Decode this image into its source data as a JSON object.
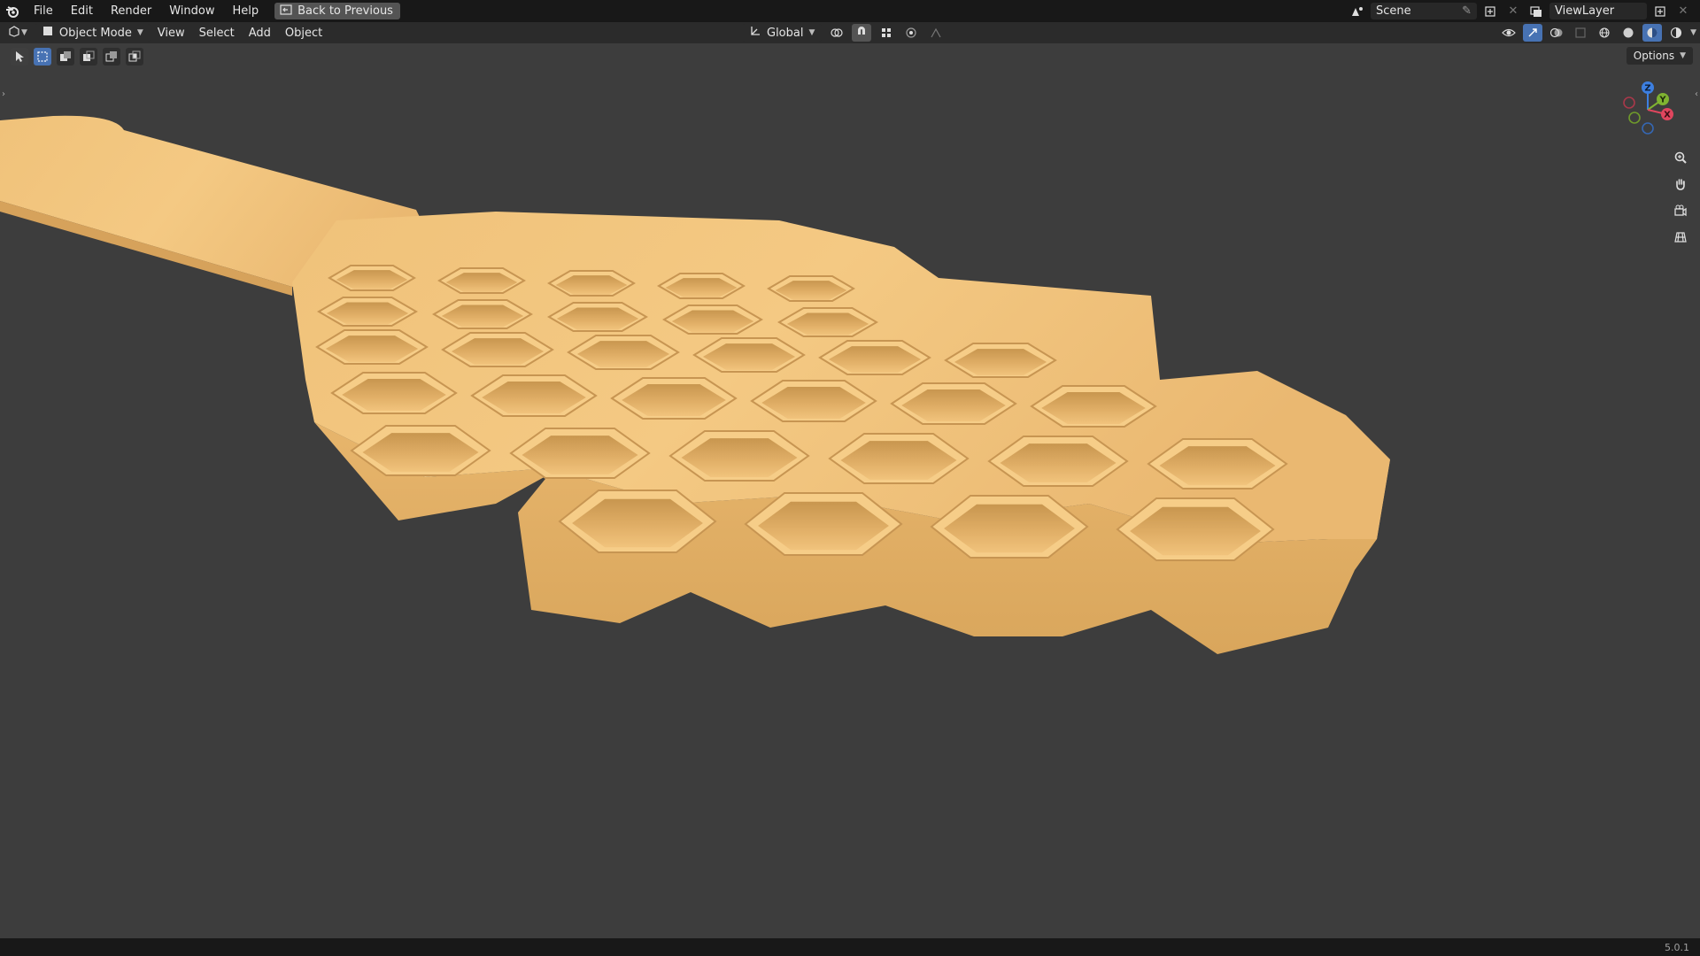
{
  "topbar": {
    "menus": [
      "File",
      "Edit",
      "Render",
      "Window",
      "Help"
    ],
    "back_button": "Back to Previous",
    "scene": "Scene",
    "view_layer": "ViewLayer"
  },
  "header": {
    "mode": "Object Mode",
    "menus": [
      "View",
      "Select",
      "Add",
      "Object"
    ],
    "transform_orientation": "Global"
  },
  "viewport": {
    "options_label": "Options",
    "gizmo": {
      "x_label": "X",
      "y_label": "Y",
      "z_label": "Z"
    }
  },
  "status": {
    "version": "5.0.1"
  },
  "colors": {
    "accent": "#4772b3",
    "wood": "#e9b86a",
    "background": "#3d3d3d"
  }
}
